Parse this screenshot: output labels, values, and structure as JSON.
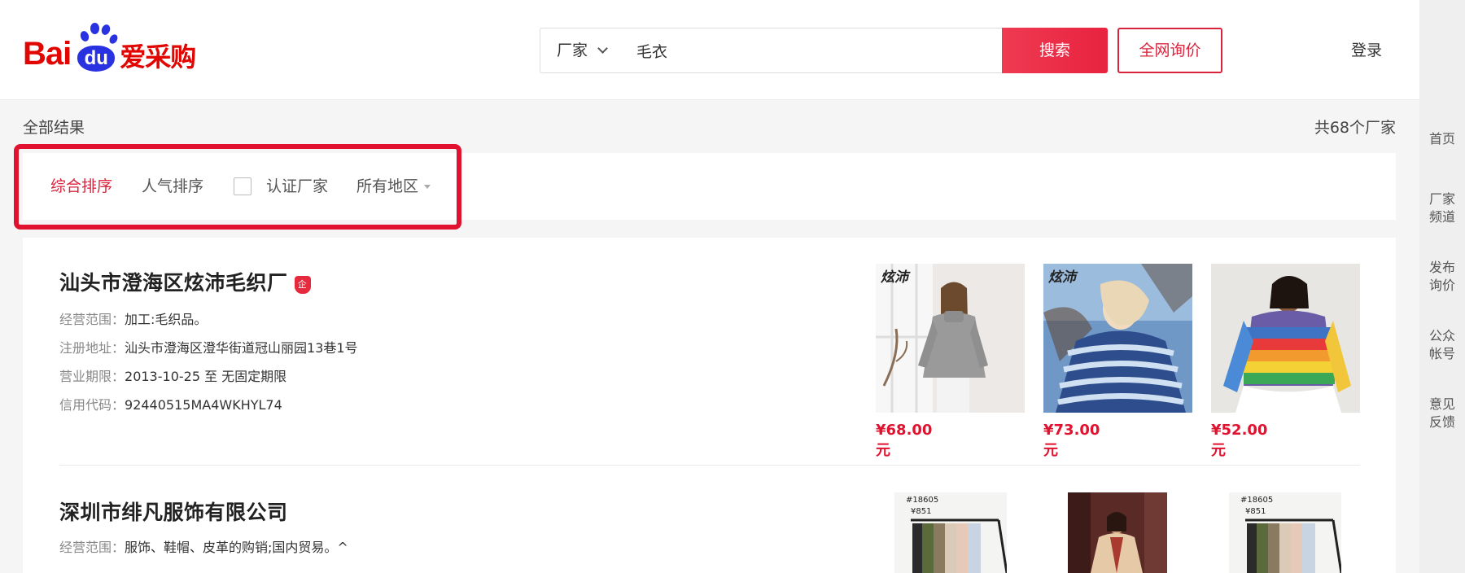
{
  "header": {
    "logo": {
      "part1": "Bai",
      "paw_text": "du",
      "part2": "爱采购"
    },
    "search": {
      "type_selected": "厂家",
      "query": "毛衣",
      "button": "搜索"
    },
    "inquiry_button": "全网询价",
    "login": "登录"
  },
  "right_bar": [
    {
      "label": "首页"
    },
    {
      "label": "厂家\n频道"
    },
    {
      "label": "发布\n询价"
    },
    {
      "label": "公众\n帐号"
    },
    {
      "label": "意见\n反馈"
    }
  ],
  "results": {
    "title": "全部结果",
    "count": "共68个厂家"
  },
  "filters": {
    "sort_composite": "综合排序",
    "sort_popularity": "人气排序",
    "certified": "认证厂家",
    "region": "所有地区"
  },
  "companies": [
    {
      "name": "汕头市澄海区炫沛毛织厂",
      "badge": "企",
      "fields": [
        {
          "label": "经营范围：",
          "value": "加工:毛织品。"
        },
        {
          "label": "注册地址：",
          "value": "汕头市澄海区澄华街道冠山丽园13巷1号"
        },
        {
          "label": "营业期限：",
          "value": "2013-10-25 至 无固定期限"
        },
        {
          "label": "信用代码：",
          "value": "92440515MA4WKHYL74"
        }
      ],
      "products": [
        {
          "price": "¥68.00元",
          "watermark": "炫沛",
          "desc": "grey turtleneck sweater"
        },
        {
          "price": "¥73.00元",
          "watermark": "炫沛",
          "desc": "blue striped sweater"
        },
        {
          "price": "¥52.00元",
          "desc": "rainbow striped sweater"
        }
      ]
    },
    {
      "name": "深圳市绯凡服饰有限公司",
      "fields": [
        {
          "label": "经营范围：",
          "value": "服饰、鞋帽、皮革的购销;国内贸易。^"
        }
      ],
      "products": [
        {
          "tag": "#18605\n¥851"
        },
        {
          "tag": ""
        },
        {
          "tag": "#18605\n¥851"
        }
      ]
    }
  ],
  "colors": {
    "accent": "#e0122f",
    "brand_blue": "#2932e1"
  }
}
